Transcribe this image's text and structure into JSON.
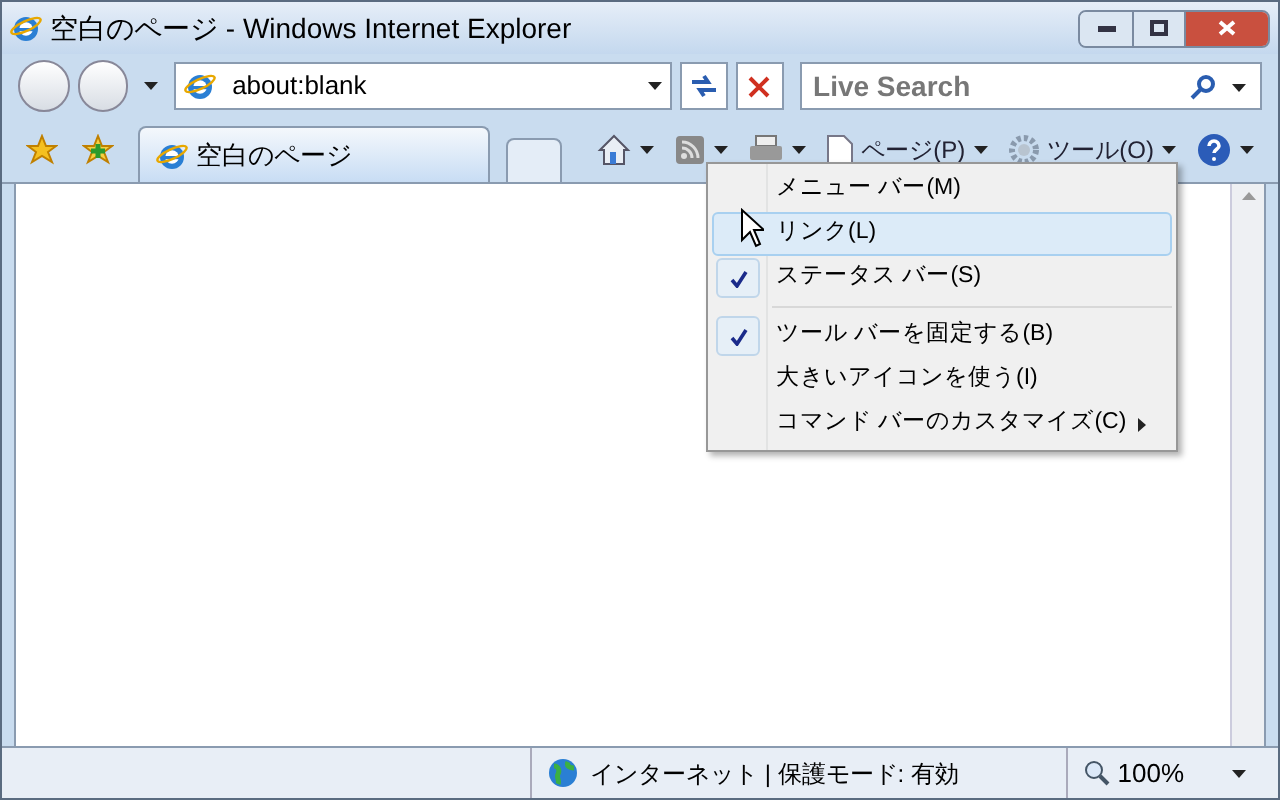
{
  "window": {
    "title": "空白のページ - Windows Internet Explorer"
  },
  "address": {
    "value": "about:blank"
  },
  "search": {
    "placeholder": "Live Search"
  },
  "tabs": [
    {
      "label": "空白のページ",
      "selected": true
    }
  ],
  "toolbar": [
    {
      "kind": "home"
    },
    {
      "kind": "feed"
    },
    {
      "kind": "print"
    },
    {
      "kind": "page",
      "label": "ページ(P)"
    },
    {
      "kind": "tools",
      "label": "ツール(O)"
    },
    {
      "kind": "help"
    }
  ],
  "menu": [
    {
      "label": "メニュー バー(M)",
      "checked": false,
      "selected": false
    },
    {
      "label": "リンク(L)",
      "checked": false,
      "selected": true
    },
    {
      "label": "ステータス バー(S)",
      "checked": true,
      "selected": false,
      "separator_after": true
    },
    {
      "label": "ツール バーを固定する(B)",
      "checked": true,
      "selected": false
    },
    {
      "label": "大きいアイコンを使う(I)",
      "checked": false,
      "selected": false
    },
    {
      "label": "コマンド バーのカスタマイズ(C)",
      "checked": false,
      "selected": false,
      "submenu": true
    }
  ],
  "status_bar": {
    "zone": "インターネット | 保護モード: 有効",
    "zoom": "100%"
  }
}
